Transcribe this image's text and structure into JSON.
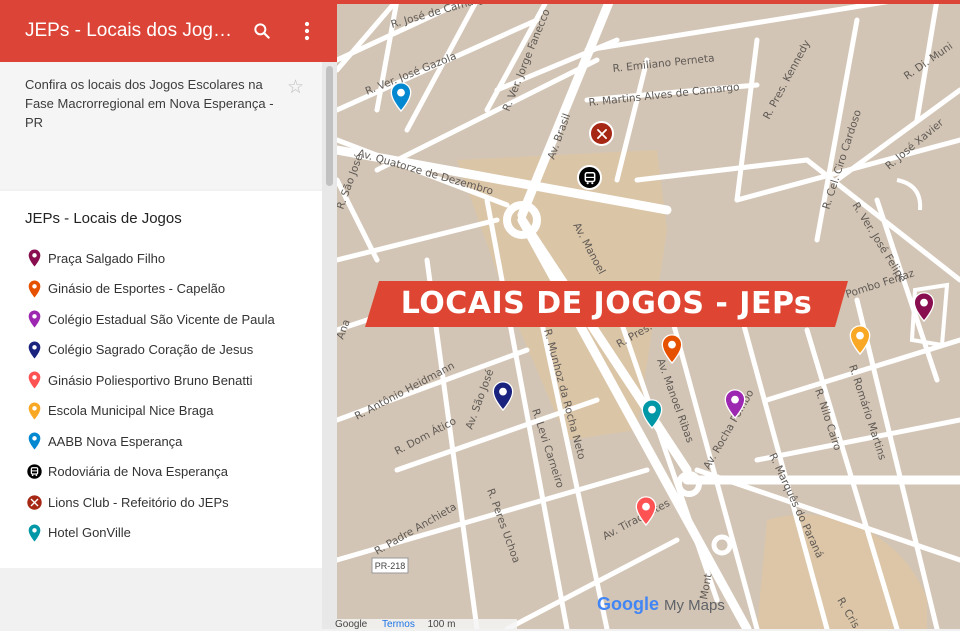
{
  "app": {
    "title": "JEPs - Locais dos Jogos…"
  },
  "description": "Confira os locais dos Jogos Escolares na Fase Macrorregional em Nova Esperança - PR",
  "layer": {
    "title": "JEPs - Locais de Jogos",
    "items": [
      {
        "label": "Praça Salgado Filho",
        "icon": "pin-icon",
        "color": "#880e4f"
      },
      {
        "label": "Ginásio de Esportes - Capelão",
        "icon": "pin-icon",
        "color": "#e65100"
      },
      {
        "label": "Colégio Estadual São Vicente de Paula",
        "icon": "pin-icon",
        "color": "#9c27b0"
      },
      {
        "label": "Colégio Sagrado Coração de Jesus",
        "icon": "pin-icon",
        "color": "#1a237e"
      },
      {
        "label": "Ginásio Poliesportivo Bruno Benatti",
        "icon": "pin-icon",
        "color": "#ff5252"
      },
      {
        "label": "Escola Municipal Nice Braga",
        "icon": "pin-icon",
        "color": "#f9a825"
      },
      {
        "label": "AABB Nova Esperança",
        "icon": "pin-icon",
        "color": "#0288d1"
      },
      {
        "label": "Rodoviária de Nova Esperança",
        "icon": "bus-icon",
        "color": "#000000"
      },
      {
        "label": "Lions Club - Refeitório do JEPs",
        "icon": "cutlery-icon",
        "color": "#a52714"
      },
      {
        "label": "Hotel GonVille",
        "icon": "pin-icon",
        "color": "#0097a7"
      }
    ]
  },
  "map": {
    "banner": "LOCAIS DE JOGOS - JEPs",
    "streets": {
      "ver_jose_gazola": "R. Ver. José Gazola",
      "jose_camargo": "R. José de Camargo",
      "ver_jorge_fanecco": "R. Ver. Jorge Fanecco",
      "emiliano_perneta": "R. Emiliano Perneta",
      "martins_alves": "R. Martins Alves de Camargo",
      "av_brasil": "Av. Brasil",
      "av_quatorze": "Av. Quatorze de Dezembro",
      "pres_kennedy": "R. Pres. Kennedy",
      "cel_ciro": "R. Cel. Ciro Cardoso",
      "jose_xavier": "R. José Xavier",
      "sao_jose": "R. São José",
      "av_manoel": "Av. Manoel",
      "ver_jose_felipe": "R. Ver. José Felipe",
      "r_di": "R. Di. Muni",
      "av_sao_jose": "Av. São José",
      "antonio_heidmann": "R. Antônio Heidmann",
      "dom_atico": "R. Dom Ático",
      "levi_carneiro": "R. Levi Carneiro",
      "munhoz": "R. Munhoz da Rocha Neto",
      "pres": "R. Pres.",
      "av_manoel_ribas": "Av. Manoel Ribas",
      "av_rocha": "Av. Rocha Pombo",
      "nilo_cairo": "R. Nilo Cairo",
      "romario": "R. Romário Martins",
      "marques": "R. Marquês do Paraná",
      "padre_anchieta": "R. Padre Anchieta",
      "peres_uchoa": "R. Peres Uchoa",
      "av_tiradentes": "Av. Tiradentes",
      "pombo_ferraz": "Pombo Ferraz",
      "ana": "Ana",
      "mont": "Mont",
      "cris": "R. Cris"
    },
    "route_shield": "PR-218",
    "brand_google": "Google",
    "brand_mymaps": "My Maps",
    "footer_google": "Google",
    "footer_terms": "Termos",
    "footer_scale": "100 m"
  }
}
